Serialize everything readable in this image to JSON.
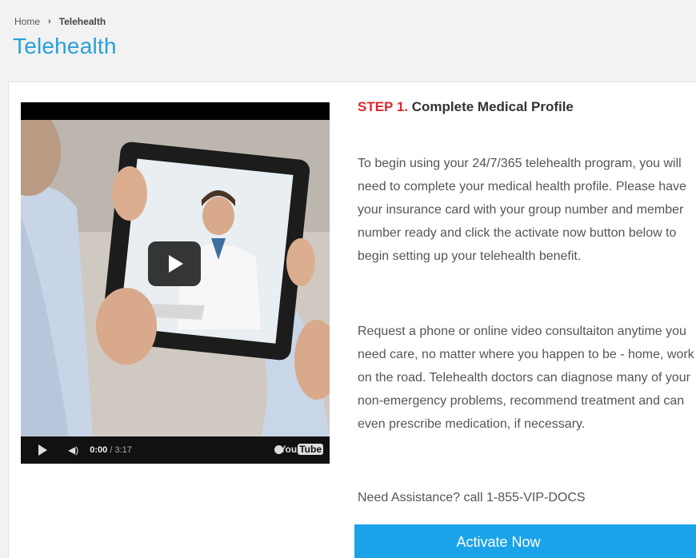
{
  "breadcrumb": {
    "home": "Home",
    "separator": "›",
    "current": "Telehealth"
  },
  "page_title": "Telehealth",
  "video": {
    "current_time": "0:00",
    "duration": "/ 3:17",
    "brand_left": "You",
    "brand_right": "Tube"
  },
  "step": {
    "number": "STEP 1.",
    "title": "Complete Medical Profile"
  },
  "paragraph1": "To begin using your 24/7/365 telehealth program, you will need to complete your medical health profile. Please have your insurance card with your group number and member number ready and click the activate now button below to begin setting up your telehealth benefit.",
  "paragraph2": "Request a phone or online video consultaiton anytime you need care, no matter where you happen to be - home, work or on the road. Telehealth doctors can diagnose many of your non-emergency problems, recommend treatment and can even prescribe medication, if necessary.",
  "assistance": "Need Assistance? call 1-855-VIP-DOCS",
  "activate_button": "Activate Now",
  "colors": {
    "title_blue": "#2a9fd8",
    "step_red": "#e0262d",
    "button_blue": "#1aa3e8"
  }
}
